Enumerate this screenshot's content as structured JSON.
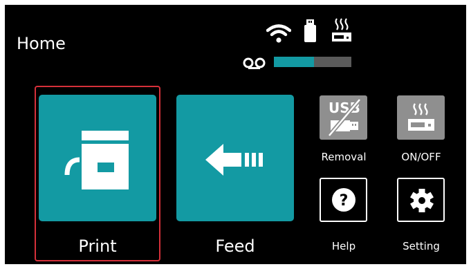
{
  "header": {
    "title": "Home"
  },
  "status": {
    "icons": [
      "wifi-icon",
      "usb-drive-icon",
      "heater-icon",
      "supply-roll-icon"
    ],
    "supply_level_percent": 52
  },
  "main": {
    "print": {
      "label": "Print",
      "icon": "printer-icon",
      "selected": true
    },
    "feed": {
      "label": "Feed",
      "icon": "feed-arrow-icon"
    }
  },
  "side": {
    "removal": {
      "label": "Removal",
      "icon": "usb-removal-icon",
      "icon_text": "USB"
    },
    "onoff": {
      "label": "ON/OFF",
      "icon": "heater-toggle-icon"
    },
    "help": {
      "label": "Help",
      "icon": "help-icon",
      "icon_text": "?"
    },
    "setting": {
      "label": "Setting",
      "icon": "gear-icon"
    }
  },
  "colors": {
    "accent": "#139aa3",
    "background": "#000000",
    "selection": "#d6303a",
    "tile_gray": "#8f8f8f",
    "bar_track": "#5a5a5a"
  }
}
